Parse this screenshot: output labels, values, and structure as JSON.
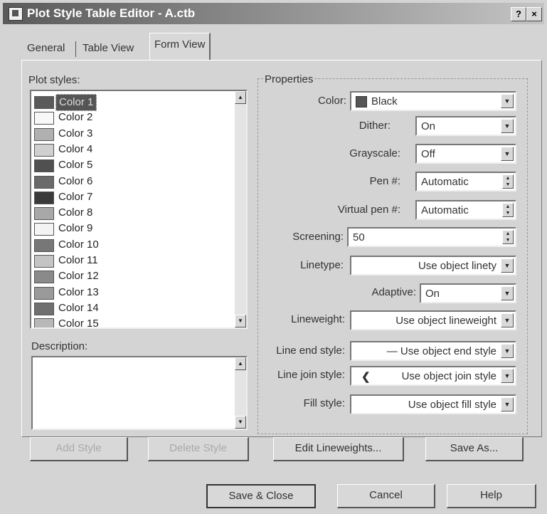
{
  "window": {
    "title": "Plot Style Table Editor - A.ctb",
    "help_button": "?",
    "close_button": "×"
  },
  "tabs": [
    {
      "label": "General"
    },
    {
      "label": "Table View"
    },
    {
      "label": "Form View"
    }
  ],
  "plot_styles": {
    "label": "Plot styles:",
    "items": [
      {
        "label": "Color 1",
        "swatch": "#5a5a5a",
        "selected": true
      },
      {
        "label": "Color 2",
        "swatch": "#f8f8f8"
      },
      {
        "label": "Color 3",
        "swatch": "#b0b0b0"
      },
      {
        "label": "Color 4",
        "swatch": "#d0d0d0"
      },
      {
        "label": "Color 5",
        "swatch": "#505050"
      },
      {
        "label": "Color 6",
        "swatch": "#6a6a6a"
      },
      {
        "label": "Color 7",
        "swatch": "#3a3a3a"
      },
      {
        "label": "Color 8",
        "swatch": "#a8a8a8"
      },
      {
        "label": "Color 9",
        "swatch": "#f4f4f4"
      },
      {
        "label": "Color 10",
        "swatch": "#777777"
      },
      {
        "label": "Color 11",
        "swatch": "#c4c4c4"
      },
      {
        "label": "Color 12",
        "swatch": "#8a8a8a"
      },
      {
        "label": "Color 13",
        "swatch": "#9a9a9a"
      },
      {
        "label": "Color 14",
        "swatch": "#707070"
      },
      {
        "label": "Color 15",
        "swatch": "#b8b8b8"
      }
    ]
  },
  "description": {
    "label": "Description:",
    "value": ""
  },
  "properties": {
    "label": "Properties",
    "color": {
      "label": "Color:",
      "value": "Black"
    },
    "dither": {
      "label": "Dither:",
      "value": "On"
    },
    "grayscale": {
      "label": "Grayscale:",
      "value": "Off"
    },
    "pen": {
      "label": "Pen #:",
      "value": "Automatic"
    },
    "virtual_pen": {
      "label": "Virtual pen #:",
      "value": "Automatic"
    },
    "screening": {
      "label": "Screening:",
      "value": "50"
    },
    "linetype": {
      "label": "Linetype:",
      "value": "Use object linety"
    },
    "adaptive": {
      "label": "Adaptive:",
      "value": "On"
    },
    "lineweight": {
      "label": "Lineweight:",
      "value": "Use object lineweight"
    },
    "line_end_style": {
      "label": "Line end style:",
      "value": "— Use object end style"
    },
    "line_join_style": {
      "label": "Line join style:",
      "value": "Use object join style"
    },
    "fill_style": {
      "label": "Fill style:",
      "value": "Use object fill style"
    }
  },
  "buttons": {
    "add_style": "Add Style",
    "delete_style": "Delete Style",
    "edit_lineweights": "Edit Lineweights...",
    "save_as": "Save As...",
    "save_close": "Save & Close",
    "cancel": "Cancel",
    "help": "Help"
  }
}
